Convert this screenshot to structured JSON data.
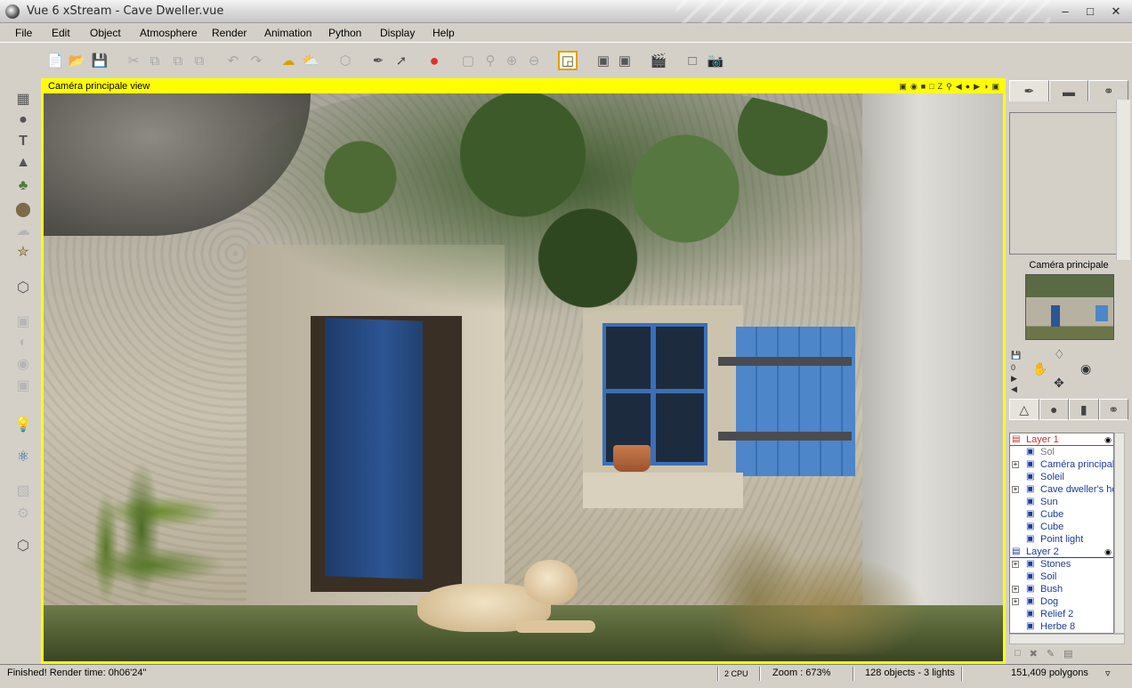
{
  "window": {
    "title": "Vue 6 xStream - Cave Dweller.vue",
    "minimize": "–",
    "maximize": "□",
    "close": "✕"
  },
  "menu": [
    "File",
    "Edit",
    "Object",
    "Atmosphere",
    "Render",
    "Animation",
    "Python",
    "Display",
    "Help"
  ],
  "toolbar": {
    "icons": [
      "new-icon",
      "open-icon",
      "save-icon",
      "cut-icon",
      "copy-icon",
      "paste-icon",
      "duplicate-icon",
      "undo-icon",
      "redo-icon",
      "atmosphere-editor-icon",
      "weather-icon",
      "object-icon",
      "material-icon",
      "pointer-icon",
      "color-palette-icon",
      "zoom-fit-icon",
      "zoom-region-icon",
      "zoom-in-icon",
      "zoom-out-icon",
      "camera-view-icon",
      "render-area-icon",
      "render-options-icon",
      "animation-icon",
      "render-region-icon",
      "render-icon"
    ]
  },
  "left_tools": [
    "terrain-icon",
    "sphere-icon",
    "text-icon",
    "plant-icon",
    "tree-icon",
    "rock-icon",
    "cloud-icon",
    "planet-icon",
    "object-library-icon",
    "group-icon",
    "boolean-icon",
    "metablob-icon",
    "hyperblob-icon",
    "light-icon",
    "animation-wizard-icon",
    "camera-icon",
    "ecosystem-icon",
    "load-icon"
  ],
  "viewport": {
    "title": "Caméra principale view",
    "header_icons": [
      "render-icon",
      "camera-icon",
      "color-icon",
      "white-icon",
      "z-icon",
      "zoom-icon",
      "pan-left-icon",
      "speed-icon",
      "pan-right-icon",
      "contrast-icon",
      "save-icon"
    ]
  },
  "status": {
    "message": "Finished! Render time: 0h06'24\"",
    "cpu": "2 CPU",
    "zoom": "Zoom : 673%",
    "objects": "128 objects - 3 lights",
    "polygons": "151,409 polygons"
  },
  "right_panel": {
    "tabs": [
      "brush-icon",
      "ruler-icon",
      "link-icon"
    ],
    "camera_label": "Caméra principale",
    "nav_zero": "0",
    "object_tabs": [
      "layers-icon",
      "materials-icon",
      "libraries-icon",
      "links-icon"
    ],
    "tree": [
      {
        "type": "layer",
        "label": "Layer 1",
        "color": "#c53030"
      },
      {
        "type": "item",
        "label": "Sol",
        "icon": "ground-icon",
        "expandable": false,
        "dim": true
      },
      {
        "type": "item",
        "label": "Caméra principale",
        "icon": "camera-icon",
        "expandable": true
      },
      {
        "type": "item",
        "label": "Soleil",
        "icon": "sun-icon",
        "expandable": false
      },
      {
        "type": "item",
        "label": "Cave dweller's ho",
        "icon": "group-icon",
        "expandable": true
      },
      {
        "type": "item",
        "label": "Sun",
        "icon": "sun-icon",
        "expandable": false
      },
      {
        "type": "item",
        "label": "Cube",
        "icon": "cube-icon",
        "expandable": false
      },
      {
        "type": "item",
        "label": "Cube",
        "icon": "cube-icon",
        "expandable": false
      },
      {
        "type": "item",
        "label": "Point light",
        "icon": "light-icon",
        "expandable": false
      },
      {
        "type": "layer2",
        "label": "Layer 2",
        "color": "#1e3b9a"
      },
      {
        "type": "item",
        "label": "Stones",
        "icon": "group-icon",
        "expandable": true
      },
      {
        "type": "item",
        "label": "Soil",
        "icon": "terrain-icon",
        "expandable": false
      },
      {
        "type": "item",
        "label": "Bush",
        "icon": "group-icon",
        "expandable": true
      },
      {
        "type": "item",
        "label": "Dog",
        "icon": "group-icon",
        "expandable": true
      },
      {
        "type": "item",
        "label": "Relief 2",
        "icon": "terrain-icon",
        "expandable": false
      },
      {
        "type": "item",
        "label": "Herbe 8",
        "icon": "plant-icon",
        "expandable": false
      }
    ]
  },
  "colors": {
    "viewport_border": "#ffff00",
    "chrome": "#d4d0c8",
    "layer1": "#c53030",
    "layer2": "#1e3b9a"
  }
}
